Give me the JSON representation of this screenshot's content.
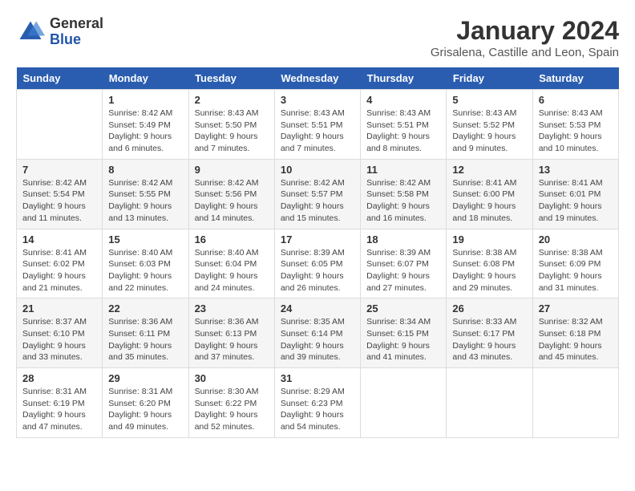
{
  "header": {
    "logo_general": "General",
    "logo_blue": "Blue",
    "title": "January 2024",
    "subtitle": "Grisalena, Castille and Leon, Spain"
  },
  "calendar": {
    "days_of_week": [
      "Sunday",
      "Monday",
      "Tuesday",
      "Wednesday",
      "Thursday",
      "Friday",
      "Saturday"
    ],
    "weeks": [
      [
        {
          "day": "",
          "sunrise": "",
          "sunset": "",
          "daylight": ""
        },
        {
          "day": "1",
          "sunrise": "Sunrise: 8:42 AM",
          "sunset": "Sunset: 5:49 PM",
          "daylight": "Daylight: 9 hours and 6 minutes."
        },
        {
          "day": "2",
          "sunrise": "Sunrise: 8:43 AM",
          "sunset": "Sunset: 5:50 PM",
          "daylight": "Daylight: 9 hours and 7 minutes."
        },
        {
          "day": "3",
          "sunrise": "Sunrise: 8:43 AM",
          "sunset": "Sunset: 5:51 PM",
          "daylight": "Daylight: 9 hours and 7 minutes."
        },
        {
          "day": "4",
          "sunrise": "Sunrise: 8:43 AM",
          "sunset": "Sunset: 5:51 PM",
          "daylight": "Daylight: 9 hours and 8 minutes."
        },
        {
          "day": "5",
          "sunrise": "Sunrise: 8:43 AM",
          "sunset": "Sunset: 5:52 PM",
          "daylight": "Daylight: 9 hours and 9 minutes."
        },
        {
          "day": "6",
          "sunrise": "Sunrise: 8:43 AM",
          "sunset": "Sunset: 5:53 PM",
          "daylight": "Daylight: 9 hours and 10 minutes."
        }
      ],
      [
        {
          "day": "7",
          "sunrise": "Sunrise: 8:42 AM",
          "sunset": "Sunset: 5:54 PM",
          "daylight": "Daylight: 9 hours and 11 minutes."
        },
        {
          "day": "8",
          "sunrise": "Sunrise: 8:42 AM",
          "sunset": "Sunset: 5:55 PM",
          "daylight": "Daylight: 9 hours and 13 minutes."
        },
        {
          "day": "9",
          "sunrise": "Sunrise: 8:42 AM",
          "sunset": "Sunset: 5:56 PM",
          "daylight": "Daylight: 9 hours and 14 minutes."
        },
        {
          "day": "10",
          "sunrise": "Sunrise: 8:42 AM",
          "sunset": "Sunset: 5:57 PM",
          "daylight": "Daylight: 9 hours and 15 minutes."
        },
        {
          "day": "11",
          "sunrise": "Sunrise: 8:42 AM",
          "sunset": "Sunset: 5:58 PM",
          "daylight": "Daylight: 9 hours and 16 minutes."
        },
        {
          "day": "12",
          "sunrise": "Sunrise: 8:41 AM",
          "sunset": "Sunset: 6:00 PM",
          "daylight": "Daylight: 9 hours and 18 minutes."
        },
        {
          "day": "13",
          "sunrise": "Sunrise: 8:41 AM",
          "sunset": "Sunset: 6:01 PM",
          "daylight": "Daylight: 9 hours and 19 minutes."
        }
      ],
      [
        {
          "day": "14",
          "sunrise": "Sunrise: 8:41 AM",
          "sunset": "Sunset: 6:02 PM",
          "daylight": "Daylight: 9 hours and 21 minutes."
        },
        {
          "day": "15",
          "sunrise": "Sunrise: 8:40 AM",
          "sunset": "Sunset: 6:03 PM",
          "daylight": "Daylight: 9 hours and 22 minutes."
        },
        {
          "day": "16",
          "sunrise": "Sunrise: 8:40 AM",
          "sunset": "Sunset: 6:04 PM",
          "daylight": "Daylight: 9 hours and 24 minutes."
        },
        {
          "day": "17",
          "sunrise": "Sunrise: 8:39 AM",
          "sunset": "Sunset: 6:05 PM",
          "daylight": "Daylight: 9 hours and 26 minutes."
        },
        {
          "day": "18",
          "sunrise": "Sunrise: 8:39 AM",
          "sunset": "Sunset: 6:07 PM",
          "daylight": "Daylight: 9 hours and 27 minutes."
        },
        {
          "day": "19",
          "sunrise": "Sunrise: 8:38 AM",
          "sunset": "Sunset: 6:08 PM",
          "daylight": "Daylight: 9 hours and 29 minutes."
        },
        {
          "day": "20",
          "sunrise": "Sunrise: 8:38 AM",
          "sunset": "Sunset: 6:09 PM",
          "daylight": "Daylight: 9 hours and 31 minutes."
        }
      ],
      [
        {
          "day": "21",
          "sunrise": "Sunrise: 8:37 AM",
          "sunset": "Sunset: 6:10 PM",
          "daylight": "Daylight: 9 hours and 33 minutes."
        },
        {
          "day": "22",
          "sunrise": "Sunrise: 8:36 AM",
          "sunset": "Sunset: 6:11 PM",
          "daylight": "Daylight: 9 hours and 35 minutes."
        },
        {
          "day": "23",
          "sunrise": "Sunrise: 8:36 AM",
          "sunset": "Sunset: 6:13 PM",
          "daylight": "Daylight: 9 hours and 37 minutes."
        },
        {
          "day": "24",
          "sunrise": "Sunrise: 8:35 AM",
          "sunset": "Sunset: 6:14 PM",
          "daylight": "Daylight: 9 hours and 39 minutes."
        },
        {
          "day": "25",
          "sunrise": "Sunrise: 8:34 AM",
          "sunset": "Sunset: 6:15 PM",
          "daylight": "Daylight: 9 hours and 41 minutes."
        },
        {
          "day": "26",
          "sunrise": "Sunrise: 8:33 AM",
          "sunset": "Sunset: 6:17 PM",
          "daylight": "Daylight: 9 hours and 43 minutes."
        },
        {
          "day": "27",
          "sunrise": "Sunrise: 8:32 AM",
          "sunset": "Sunset: 6:18 PM",
          "daylight": "Daylight: 9 hours and 45 minutes."
        }
      ],
      [
        {
          "day": "28",
          "sunrise": "Sunrise: 8:31 AM",
          "sunset": "Sunset: 6:19 PM",
          "daylight": "Daylight: 9 hours and 47 minutes."
        },
        {
          "day": "29",
          "sunrise": "Sunrise: 8:31 AM",
          "sunset": "Sunset: 6:20 PM",
          "daylight": "Daylight: 9 hours and 49 minutes."
        },
        {
          "day": "30",
          "sunrise": "Sunrise: 8:30 AM",
          "sunset": "Sunset: 6:22 PM",
          "daylight": "Daylight: 9 hours and 52 minutes."
        },
        {
          "day": "31",
          "sunrise": "Sunrise: 8:29 AM",
          "sunset": "Sunset: 6:23 PM",
          "daylight": "Daylight: 9 hours and 54 minutes."
        },
        {
          "day": "",
          "sunrise": "",
          "sunset": "",
          "daylight": ""
        },
        {
          "day": "",
          "sunrise": "",
          "sunset": "",
          "daylight": ""
        },
        {
          "day": "",
          "sunrise": "",
          "sunset": "",
          "daylight": ""
        }
      ]
    ]
  }
}
